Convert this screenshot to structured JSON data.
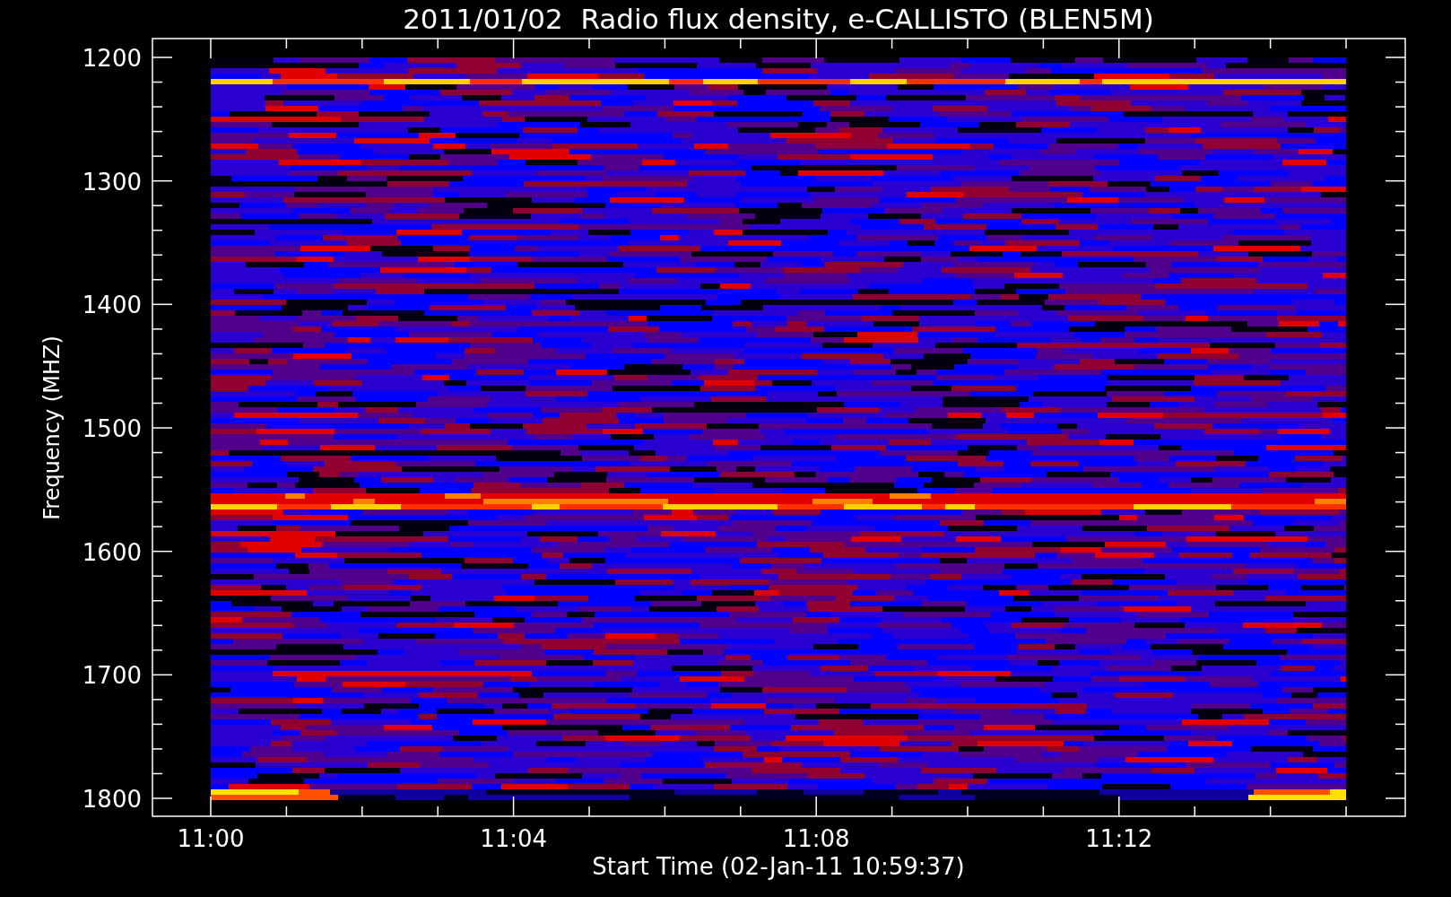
{
  "title": "2011/01/02  Radio flux density, e-CALLISTO (BLEN5M)",
  "y_axis": {
    "label": "Frequency (MHZ)",
    "ticks": [
      "1200",
      "1300",
      "1400",
      "1500",
      "1600",
      "1700",
      "1800"
    ]
  },
  "x_axis": {
    "label": "Start Time (02-Jan-11 10:59:37)",
    "ticks": [
      "11:00",
      "11:04",
      "11:08",
      "11:12"
    ]
  }
}
